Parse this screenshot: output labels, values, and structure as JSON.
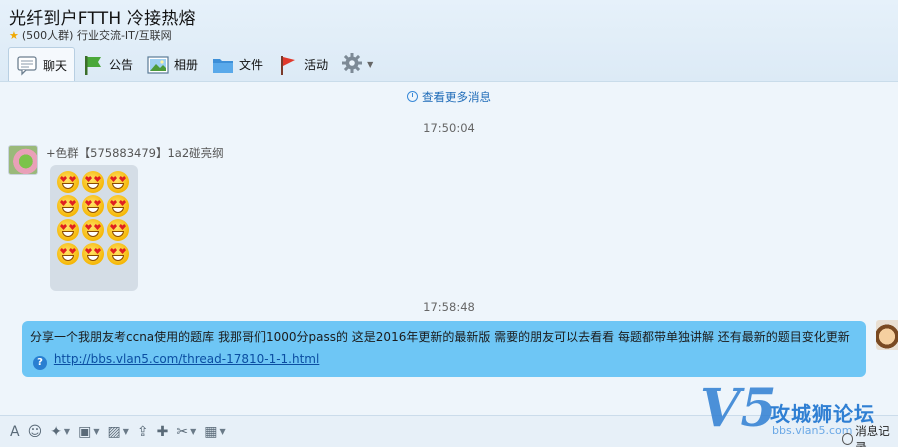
{
  "header": {
    "title": "光纤到户FTTH 冷接热熔",
    "meta": "(500人群) 行业交流-IT/互联网"
  },
  "tabs": [
    {
      "label": "聊天",
      "icon": "chat-bubble-icon",
      "active": true
    },
    {
      "label": "公告",
      "icon": "announcement-flag-icon"
    },
    {
      "label": "相册",
      "icon": "photo-album-icon"
    },
    {
      "label": "文件",
      "icon": "folder-icon"
    },
    {
      "label": "活动",
      "icon": "activity-flag-icon"
    }
  ],
  "chat": {
    "more_messages": "查看更多消息",
    "time1": "17:50:04",
    "sender": "+色群【575883479】1a2碰亮纲",
    "emoji_count": 12,
    "time2": "17:58:48",
    "my_message_text": "分享一个我朋友考ccna使用的题库 我那哥们1000分pass的 这是2016年更新的最新版 需要的朋友可以去看看 每题都带单独讲解 还有最新的题目变化更新",
    "my_message_link": "http://bbs.vlan5.com/thread-17810-1-1.html"
  },
  "toolbar": [
    {
      "name": "font-icon",
      "glyph": "A"
    },
    {
      "name": "emoji-icon",
      "glyph": "☺"
    },
    {
      "name": "magic-wand-icon",
      "glyph": "✦"
    },
    {
      "name": "gift-icon",
      "glyph": "▣"
    },
    {
      "name": "image-icon",
      "glyph": "▨"
    },
    {
      "name": "upload-icon",
      "glyph": "⇪"
    },
    {
      "name": "present-icon",
      "glyph": "✚"
    },
    {
      "name": "scissors-icon",
      "glyph": "✂"
    },
    {
      "name": "more-icon",
      "glyph": "▦"
    }
  ],
  "watermark": {
    "logo": "V5",
    "title": "攻城狮论坛",
    "url": "bbs.vlan5.com"
  },
  "message_record": "消息记录",
  "colors": {
    "accent": "#2f7fd3",
    "my_bubble": "#6ec6f5",
    "other_bubble": "#d4dde6"
  }
}
